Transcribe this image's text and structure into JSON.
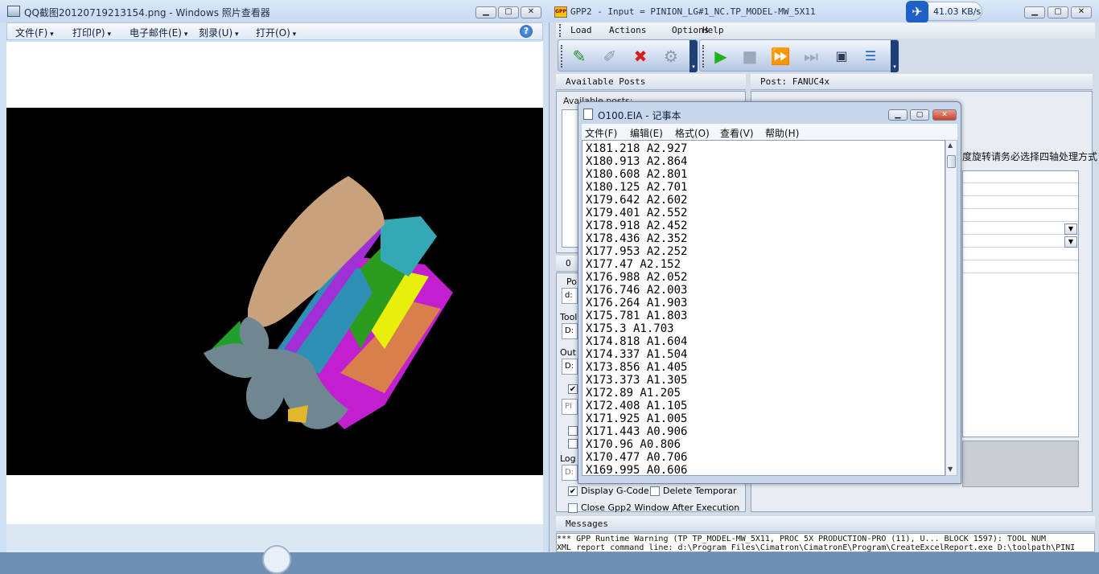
{
  "photo_viewer": {
    "title": "QQ截图20120719213154.png - Windows 照片查看器",
    "menu": [
      "文件(F)",
      "打印(P)",
      "电子邮件(E)",
      "刻录(U)",
      "打开(O)"
    ],
    "help": "?"
  },
  "gpp": {
    "title": "GPP2 - Input = PINION_LG#1_NC.TP_MODEL-MW_5X11",
    "logo": "GPP",
    "net_speed": "41.03 KB/s",
    "menu": [
      "Load",
      "Actions",
      "Options",
      "Help"
    ],
    "available_posts_header": "Available Posts",
    "available_posts_label": "Available posts:",
    "post_header": "Post: FANUC4x",
    "post_warning": "度旋转请务必选择四轴处理方式",
    "left_labels": {
      "p": "Po",
      "tool": "Tool",
      "output": "Out",
      "log": "Log"
    },
    "input_stubs": {
      "p": "d:",
      "tool": "D:",
      "output": "D:",
      "pi": "PI",
      "log": "D:"
    },
    "section_o": "O",
    "checkboxes": {
      "display_gcode": "Display G-Code",
      "delete_temp": "Delete Temporar",
      "close_window": "Close Gpp2 Window After Execution"
    },
    "messages_header": "Messages",
    "messages": [
      "*** GPP Runtime Warning (TP TP_MODEL-MW_5X11, PROC 5X PRODUCTION-PRO (11), U... BLOCK 1597): TOOL NUM",
      "XML report command line: d:\\Program Files\\Cimatron\\CimatronE\\Program\\CreateExcelReport.exe  D:\\toolpath\\PINI"
    ]
  },
  "notepad": {
    "title": "O100.EIA - 记事本",
    "menu": [
      "文件(F)",
      "编辑(E)",
      "格式(O)",
      "查看(V)",
      "帮助(H)"
    ],
    "lines": [
      "X181.218 A2.927",
      "X180.913 A2.864",
      "X180.608 A2.801",
      "X180.125 A2.701",
      "X179.642 A2.602",
      "X179.401 A2.552",
      "X178.918 A2.452",
      "X178.436 A2.352",
      "X177.953 A2.252",
      "X177.47 A2.152",
      "X176.988 A2.052",
      "X176.746 A2.003",
      "X176.264 A1.903",
      "X175.781 A1.803",
      "X175.3 A1.703",
      "X174.818 A1.604",
      "X174.337 A1.504",
      "X173.856 A1.405",
      "X173.373 A1.305",
      "X172.89 A1.205",
      "X172.408 A1.105",
      "X171.925 A1.005",
      "X171.443 A0.906",
      "X170.96 A0.806",
      "X170.477 A0.706",
      "X169.995 A0.606"
    ]
  },
  "icons": {
    "toolbar_left": [
      "load-post-icon",
      "edit-post-icon",
      "delete-post-icon",
      "post-properties-icon"
    ],
    "toolbar_right": [
      "run-icon",
      "stop-icon",
      "fast-forward-icon",
      "step-icon",
      "monitor-icon",
      "sequence-icon"
    ]
  }
}
